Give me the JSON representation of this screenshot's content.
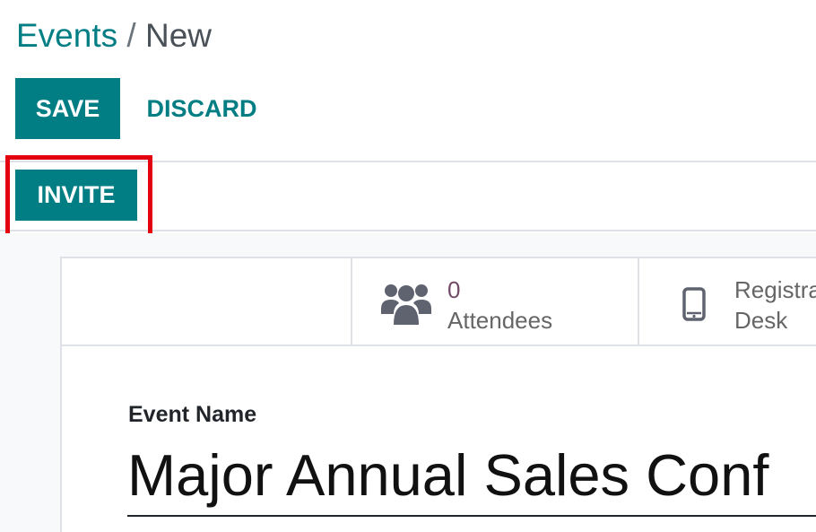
{
  "breadcrumb": {
    "parent": "Events",
    "separator": "/",
    "current": "New"
  },
  "actions": {
    "save_label": "SAVE",
    "discard_label": "DISCARD"
  },
  "statusbar": {
    "invite_label": "INVITE"
  },
  "smart_buttons": [
    {
      "value": "0",
      "label": "Attendees",
      "icon": "users-icon"
    },
    {
      "label_line1": "Registra",
      "label_line2": "Desk",
      "icon": "mobile-icon"
    }
  ],
  "form": {
    "event_name_label": "Event Name",
    "event_name_value": "Major Annual Sales Conf"
  },
  "colors": {
    "primary": "#017e84",
    "highlight": "#e3000f",
    "stat_value": "#714b67"
  }
}
